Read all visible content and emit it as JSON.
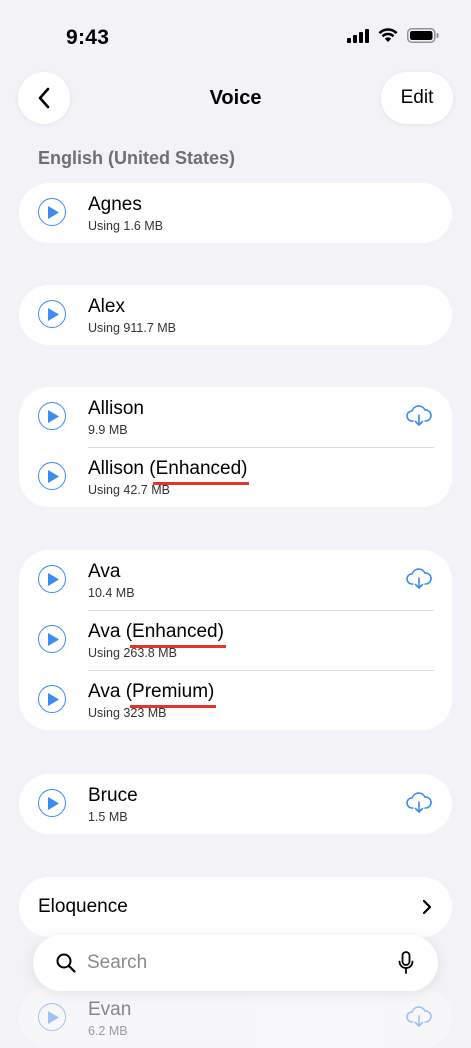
{
  "status_bar": {
    "time": "9:43"
  },
  "nav": {
    "title": "Voice",
    "edit_label": "Edit"
  },
  "section": {
    "header": "English (United States)"
  },
  "voices": {
    "agnes": {
      "name": "Agnes",
      "size": "Using 1.6 MB"
    },
    "alex": {
      "name": "Alex",
      "size": "Using 911.7 MB"
    },
    "allison": {
      "name": "Allison",
      "size": "9.9 MB"
    },
    "allison_enhanced": {
      "name": "Allison ",
      "qualifier": "(Enhanced)",
      "size": "Using 42.7 MB"
    },
    "ava": {
      "name": "Ava",
      "size": "10.4 MB"
    },
    "ava_enhanced": {
      "name": "Ava ",
      "qualifier": "(Enhanced)",
      "size": "Using 263.8 MB"
    },
    "ava_premium": {
      "name": "Ava ",
      "qualifier": "(Premium)",
      "size": "Using 323 MB"
    },
    "bruce": {
      "name": "Bruce",
      "size": "1.5 MB"
    },
    "evan": {
      "name": "Evan",
      "size": "6.2 MB"
    }
  },
  "eloquence": {
    "label": "Eloquence"
  },
  "search": {
    "placeholder": "Search"
  },
  "colors": {
    "accent": "#3a8cf0",
    "annotation": "#e2362b",
    "background": "#f2f2f7"
  }
}
